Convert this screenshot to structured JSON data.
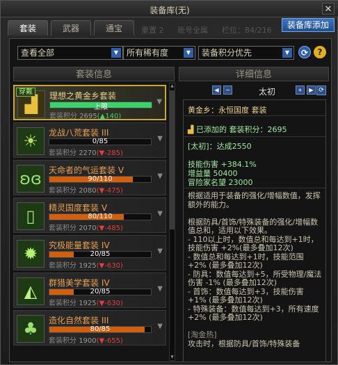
{
  "window": {
    "title": "装备库(无)"
  },
  "tabs": [
    {
      "label": "套装"
    },
    {
      "label": "武器"
    },
    {
      "label": "通宝"
    }
  ],
  "ghost_text": [
    "重置 2",
    "账号全属",
    "栏位：84/216"
  ],
  "add_button": "装备库添加",
  "filters": [
    {
      "label": "查看全部"
    },
    {
      "label": "所有稀有度"
    },
    {
      "label": "装备积分优先"
    }
  ],
  "list_header": "套装信息",
  "detail_header": "详细信息",
  "sets": [
    {
      "name": "理想之黄金乡套装",
      "name_color": "#e8d08a",
      "progress_text": "上限",
      "progress_pct": 100,
      "bar_color": "#3ad36a",
      "score_label": "套装积分",
      "score": "2695",
      "delta": "(▲140)",
      "delta_dir": "up",
      "selected": true,
      "equipped_label": "穿戴",
      "icon": "gold-bars-icon"
    },
    {
      "name": "龙战八荒套装 III",
      "name_color": "#e8a050",
      "progress_text": "0/85",
      "progress_pct": 0,
      "bar_color": "#d06010",
      "score_label": "套装积分",
      "score": "2270",
      "delta": "(▼-285)",
      "delta_dir": "down",
      "selected": false,
      "icon": "sunrise-icon"
    },
    {
      "name": "天命者的气运套装 V",
      "name_color": "#e8a050",
      "progress_text": "90/110",
      "progress_pct": 82,
      "bar_color": "#d06010",
      "score_label": "套装积分",
      "score": "2080",
      "delta": "(▼-475)",
      "delta_dir": "down",
      "selected": false,
      "icon": "butterfly-icon"
    },
    {
      "name": "精灵国度套装 V",
      "name_color": "#e8a050",
      "progress_text": "80/110",
      "progress_pct": 73,
      "bar_color": "#d06010",
      "score_label": "套装积分",
      "score": "2070",
      "delta": "(▼-485)",
      "delta_dir": "down",
      "selected": false,
      "icon": "book-icon"
    },
    {
      "name": "究极能量套装 IV",
      "name_color": "#e8a050",
      "progress_text": "20/85",
      "progress_pct": 24,
      "bar_color": "#d06010",
      "score_label": "套装积分",
      "score": "1925",
      "delta": "(▼-630)",
      "delta_dir": "down",
      "selected": false,
      "icon": "energy-burst-icon"
    },
    {
      "name": "群猎美学套装 IV",
      "name_color": "#e8a050",
      "progress_text": "20/85",
      "progress_pct": 24,
      "bar_color": "#d06010",
      "score_label": "套装积分",
      "score": "1925",
      "delta": "(▼-630)",
      "delta_dir": "down",
      "selected": false,
      "icon": "wolf-icon"
    },
    {
      "name": "造化自然套装 III",
      "name_color": "#e8a050",
      "progress_text": "80/85",
      "progress_pct": 94,
      "bar_color": "#d06010",
      "score_label": "套装积分",
      "score": "1900",
      "delta": "(▼-655)",
      "delta_dir": "down",
      "selected": false,
      "icon": "tree-icon"
    }
  ],
  "detail": {
    "page_name": "太初",
    "set_title": "黄金乡：永恒国度  套装",
    "added_score_label": "已添加的 套装积分：2695",
    "tier_line": "[太初]：达成2550",
    "stats": [
      "技能伤害 +384.1%",
      "增益量 50400",
      "冒险家名望 23000"
    ],
    "desc": [
      "根据适用于装备的强化/增幅数值，发挥额外的能力。",
      "",
      "根据防具/首饰/特殊装备的强化/增幅数值总和，适用以下效果。",
      "- 110以上时，数值总和每达到+1时，技能伤害 +2%(最多叠加12次)",
      "- 数值总和每达到+1时，技能范围 +2% (最多叠加12次)",
      "- 防具：数值每达到+5，所受物理/魔法伤害 -1% (最多叠加12次)",
      "- 首饰：数值每达到+3，技能伤害 +1% (最多叠加12次)",
      "- 特殊装备：数值每达到+3，所有速度 +2% (最多叠加12次)",
      "",
      "[淘金热]",
      "攻击时，根据防具/首饰/特殊装备"
    ]
  },
  "colors": {
    "accent": "#2f5ea8",
    "gold": "#c9a82a",
    "green": "#3ad36a",
    "orange": "#d06010"
  }
}
